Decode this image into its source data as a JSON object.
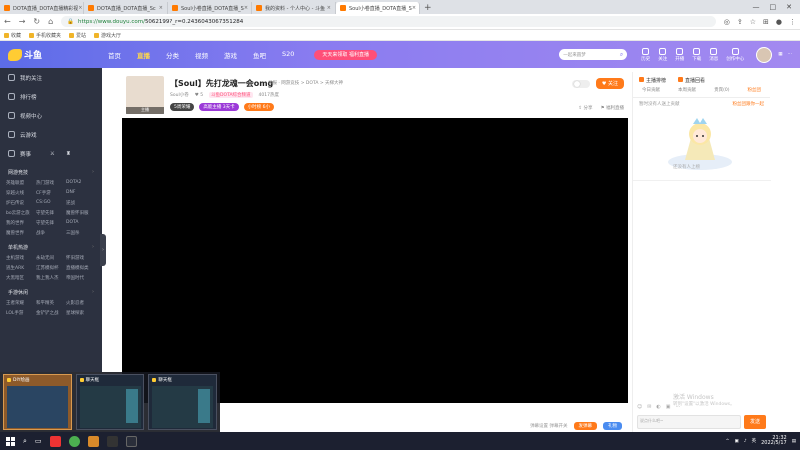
{
  "browser": {
    "tabs": [
      {
        "title": "DOTA直播_DOTA直播精彩视",
        "active": false
      },
      {
        "title": "DOTA直播_DOTA直播_Sc",
        "active": false
      },
      {
        "title": "Soul小卷直播_DOTA直播_S",
        "active": false
      },
      {
        "title": "我的资料 - 个人中心 - 斗鱼",
        "active": false
      },
      {
        "title": "Soul小卷直播_DOTA直播_S",
        "active": true
      }
    ],
    "url_host": "https://www.douyu.com/",
    "url_path": "5062199?_r=0.2436043067351284",
    "bookmarks": [
      "收藏",
      "手机收藏夹",
      "爱站",
      "游戏大厅"
    ]
  },
  "header": {
    "logo": "斗鱼",
    "nav": [
      "首页",
      "直播",
      "分类",
      "视频",
      "游戏",
      "鱼吧",
      "S20"
    ],
    "active_nav": "直播",
    "promo": "天天来领取 福利直播",
    "search_placeholder": "一起来圆梦",
    "icons": [
      "历史",
      "关注",
      "开播",
      "下载",
      "消息",
      "创作中心"
    ]
  },
  "sidebar": {
    "items": [
      "我的关注",
      "排行榜",
      "视频中心",
      "云游戏",
      "赛事"
    ],
    "sections": [
      {
        "title": "网游竞技",
        "games": [
          "英雄联盟",
          "热门游戏",
          "DOTA2",
          "穿越火线",
          "CF手游",
          "DNF",
          "炉石传说",
          "CS:GO",
          "逆战",
          "bo云游之旅",
          "守望先锋",
          "魔兽怀旧服",
          "我的世界",
          "守望先锋",
          "DOTA",
          "魔兽世界",
          "战争",
          "三国杀"
        ]
      },
      {
        "title": "单机热游",
        "games": [
          "主机游戏",
          "永劫无间",
          "怀旧游戏",
          "逃生ARK",
          "江苏模拟杯",
          "直播模拟类",
          "大黑暗区",
          "我上我人杰",
          "帝国时代"
        ]
      },
      {
        "title": "手游休闲",
        "games": [
          "王者荣耀",
          "和平精英",
          "火影忍者",
          "LOL手游",
          "金铲铲之战",
          "星球探索"
        ]
      }
    ]
  },
  "room": {
    "title": "【Soul】先打龙魂一会omg",
    "sub": "举报 · 网游竞技 > DOTA > 天梯大神",
    "avatar_label": "主播",
    "streamer": "Soul小卷",
    "fans": "5",
    "tag": "斗鱼DOTA综合频道",
    "hot": "4017热度",
    "badges": [
      "5周荣耀",
      "高能主播 3天卡",
      "小时榜 6小"
    ],
    "follow": "关注",
    "share": "分享",
    "report": "福利直播"
  },
  "rank": {
    "header_left": "主播排榜",
    "header_right": "直播回看",
    "tabs": [
      "今日贡献",
      "本周贡献",
      "贵宾(0)",
      "粉丝团"
    ],
    "notice_left": "暂时没有人送上贡献",
    "notice_right": "粉丝团跟你一起",
    "empty_text": "还没有人上榜",
    "chat_placeholder": "说点什么吧~",
    "send": "发送",
    "watermark_1": "激活 Windows",
    "watermark_2": "转到\"设置\"以激活 Windows。"
  },
  "thumbnails": [
    {
      "title": "DIY绘画",
      "active": true
    },
    {
      "title": "聊天框",
      "active": false
    },
    {
      "title": "聊天框",
      "active": false
    }
  ],
  "bottom_bar": {
    "text": "弹幕设置 弹幕开关",
    "btn1": "发弹幕",
    "btn2": "礼物"
  },
  "taskbar": {
    "time": "21:32",
    "date": "2022/5/17"
  }
}
